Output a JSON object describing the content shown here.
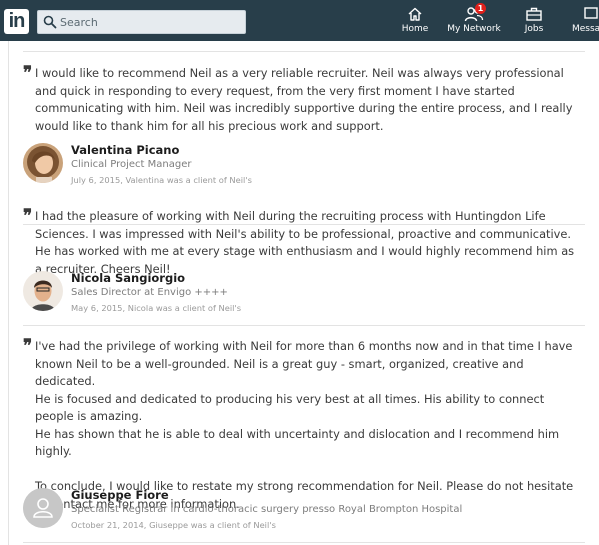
{
  "nav": {
    "logo_text": "in",
    "search": {
      "placeholder": "Search",
      "value": ""
    },
    "items": [
      {
        "label": "Home",
        "icon": "home-icon"
      },
      {
        "label": "My Network",
        "icon": "network-icon",
        "badge": "1"
      },
      {
        "label": "Jobs",
        "icon": "briefcase-icon"
      },
      {
        "label": "Messa",
        "icon": "messaging-icon"
      }
    ]
  },
  "recommendations": [
    {
      "quote_mark": "❞",
      "text": "I would like to recommend Neil as a very reliable recruiter. Neil was always very professional and quick in responding to every request, from the very first moment I have started communicating with him. Neil was incredibly supportive during the entire process, and I really would like to thank him for all his precious work and support.",
      "author_name": "Valentina Picano",
      "author_title": "Clinical Project Manager",
      "meta": "July 6, 2015, Valentina was a client of Neil's"
    },
    {
      "quote_mark": "❞",
      "text": "I had the pleasure of working with Neil during the recruiting process with Huntingdon Life Sciences. I was impressed with Neil's ability to be professional, proactive and communicative. He has worked with me at every stage with enthusiasm and I would highly recommend him as a recruiter. Cheers Neil!",
      "author_name": "Nicola Sangiorgio",
      "author_title": "Sales Director at Envigo ++++",
      "meta": "May 6, 2015, Nicola was a client of Neil's"
    },
    {
      "quote_mark": "❞",
      "text": "I've had the privilege of working with Neil for more than 6 months now and in that time I have known Neil to be a well-grounded. Neil is a great guy - smart, organized, creative and dedicated.\nHe is focused and dedicated to producing his very best at all times. His ability to connect people is amazing.\nHe has shown that he is able to deal with uncertainty and dislocation and I recommend him highly.\n\nTo conclude, I would like to restate my strong recommendation for Neil. Please do not hesitate to contact me for more information.",
      "author_name": "Giuseppe Fiore",
      "author_title": "Specialist Registrar in cardio-thoracic surgery presso Royal Brompton Hospital",
      "meta": "October 21, 2014, Giuseppe was a client of Neil's"
    }
  ]
}
